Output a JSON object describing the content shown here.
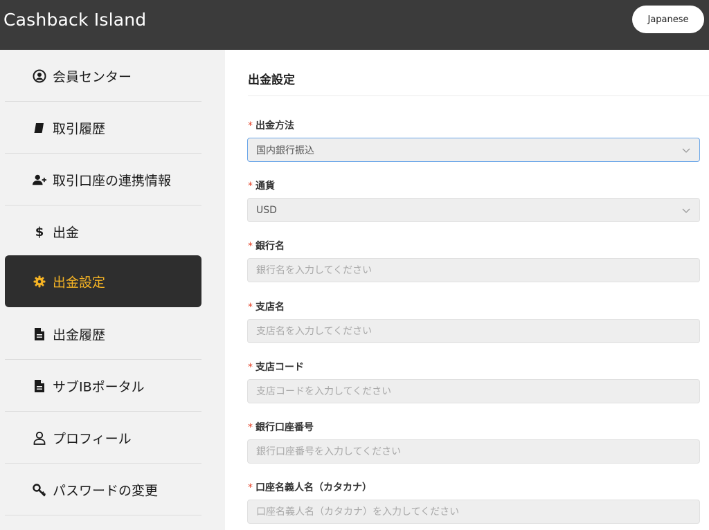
{
  "header": {
    "brand": "Cashback Island",
    "language": "Japanese"
  },
  "sidebar": {
    "items": [
      {
        "label": "会員センター",
        "icon": "user-circle-icon"
      },
      {
        "label": "取引履歴",
        "icon": "book-icon"
      },
      {
        "label": "取引口座の連携情報",
        "icon": "user-plus-icon"
      },
      {
        "label": "出金",
        "icon": "dollar-icon"
      },
      {
        "label": "出金設定",
        "icon": "gear-icon",
        "active": true
      },
      {
        "label": "出金履歴",
        "icon": "document-icon"
      },
      {
        "label": "サブIBポータル",
        "icon": "document-icon"
      },
      {
        "label": "プロフィール",
        "icon": "user-outline-icon"
      },
      {
        "label": "パスワードの変更",
        "icon": "key-icon"
      }
    ]
  },
  "main": {
    "title": "出金設定",
    "form": {
      "method": {
        "label": "出金方法",
        "value": "国内銀行振込"
      },
      "currency": {
        "label": "通貨",
        "value": "USD"
      },
      "bank_name": {
        "label": "銀行名",
        "placeholder": "銀行名を入力してください"
      },
      "branch_name": {
        "label": "支店名",
        "placeholder": "支店名を入力してください"
      },
      "branch_code": {
        "label": "支店コード",
        "placeholder": "支店コードを入力してください"
      },
      "account_number": {
        "label": "銀行口座番号",
        "placeholder": "銀行口座番号を入力してください"
      },
      "account_holder": {
        "label": "口座名義人名（カタカナ）",
        "placeholder": "口座名義人名（カタカナ）を入力してください"
      }
    }
  },
  "colors": {
    "header_bg": "#3b3b3b",
    "active_bg": "#2e2e2e",
    "active_text": "#f5b324",
    "required": "#e4452b",
    "focus_border": "#6aa6e8"
  }
}
